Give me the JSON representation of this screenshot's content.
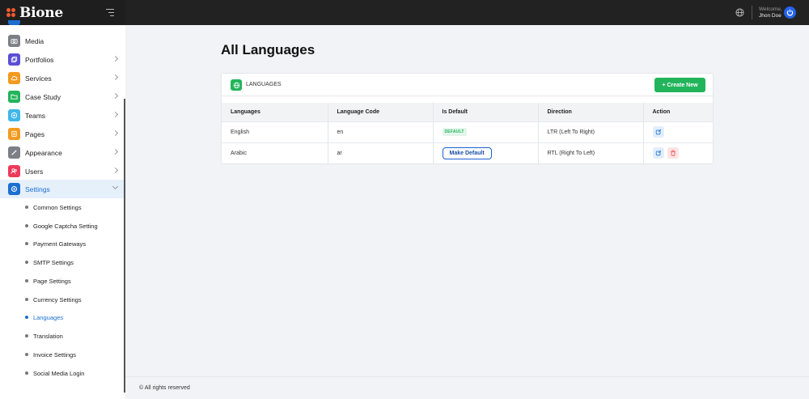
{
  "app": {
    "brand": "Bione"
  },
  "header": {
    "welcome_label": "Welcome,",
    "user_name": "Jhon Doe"
  },
  "sidebar": {
    "items": [
      {
        "label": "Media",
        "icon": "camera-icon",
        "color": "#7d7f86"
      },
      {
        "label": "Portfolios",
        "icon": "layers-icon",
        "color": "#5b4ed6"
      },
      {
        "label": "Services",
        "icon": "cloud-icon",
        "color": "#f39a1e"
      },
      {
        "label": "Case Study",
        "icon": "folder-icon",
        "color": "#22b45a"
      },
      {
        "label": "Teams",
        "icon": "plus-circle-icon",
        "color": "#3fb7e8"
      },
      {
        "label": "Pages",
        "icon": "page-icon",
        "color": "#f39a1e"
      },
      {
        "label": "Appearance",
        "icon": "brush-icon",
        "color": "#7d7f86"
      },
      {
        "label": "Users",
        "icon": "users-icon",
        "color": "#ee3a5b"
      },
      {
        "label": "Settings",
        "icon": "gear-icon",
        "color": "#1b6fd1"
      }
    ],
    "sub_items": [
      {
        "label": "Common Settings"
      },
      {
        "label": "Google Captcha Setting"
      },
      {
        "label": "Payment Gateways"
      },
      {
        "label": "SMTP Settings"
      },
      {
        "label": "Page Settings"
      },
      {
        "label": "Currency Settings"
      },
      {
        "label": "Languages"
      },
      {
        "label": "Translation"
      },
      {
        "label": "Invoice Settings"
      },
      {
        "label": "Social Media Login"
      }
    ]
  },
  "main": {
    "title": "All Languages",
    "card_title": "LANGUAGES",
    "create_label": "+ Create New",
    "columns": [
      "Languages",
      "Language Code",
      "Is Default",
      "Direction",
      "Action"
    ],
    "rows": [
      {
        "language": "English",
        "code": "en",
        "default_badge": "DEFAULT",
        "direction": "LTR (Left To Right)"
      },
      {
        "language": "Arabic",
        "code": "ar",
        "make_default_label": "Make Default",
        "direction": "RTL (Right To Left)"
      }
    ]
  },
  "footer": {
    "text": "© All rights reserved"
  },
  "colors": {
    "accent": "#1b6fd1",
    "success": "#22b45a",
    "danger": "#ee4b4b",
    "topbar": "#222222"
  }
}
